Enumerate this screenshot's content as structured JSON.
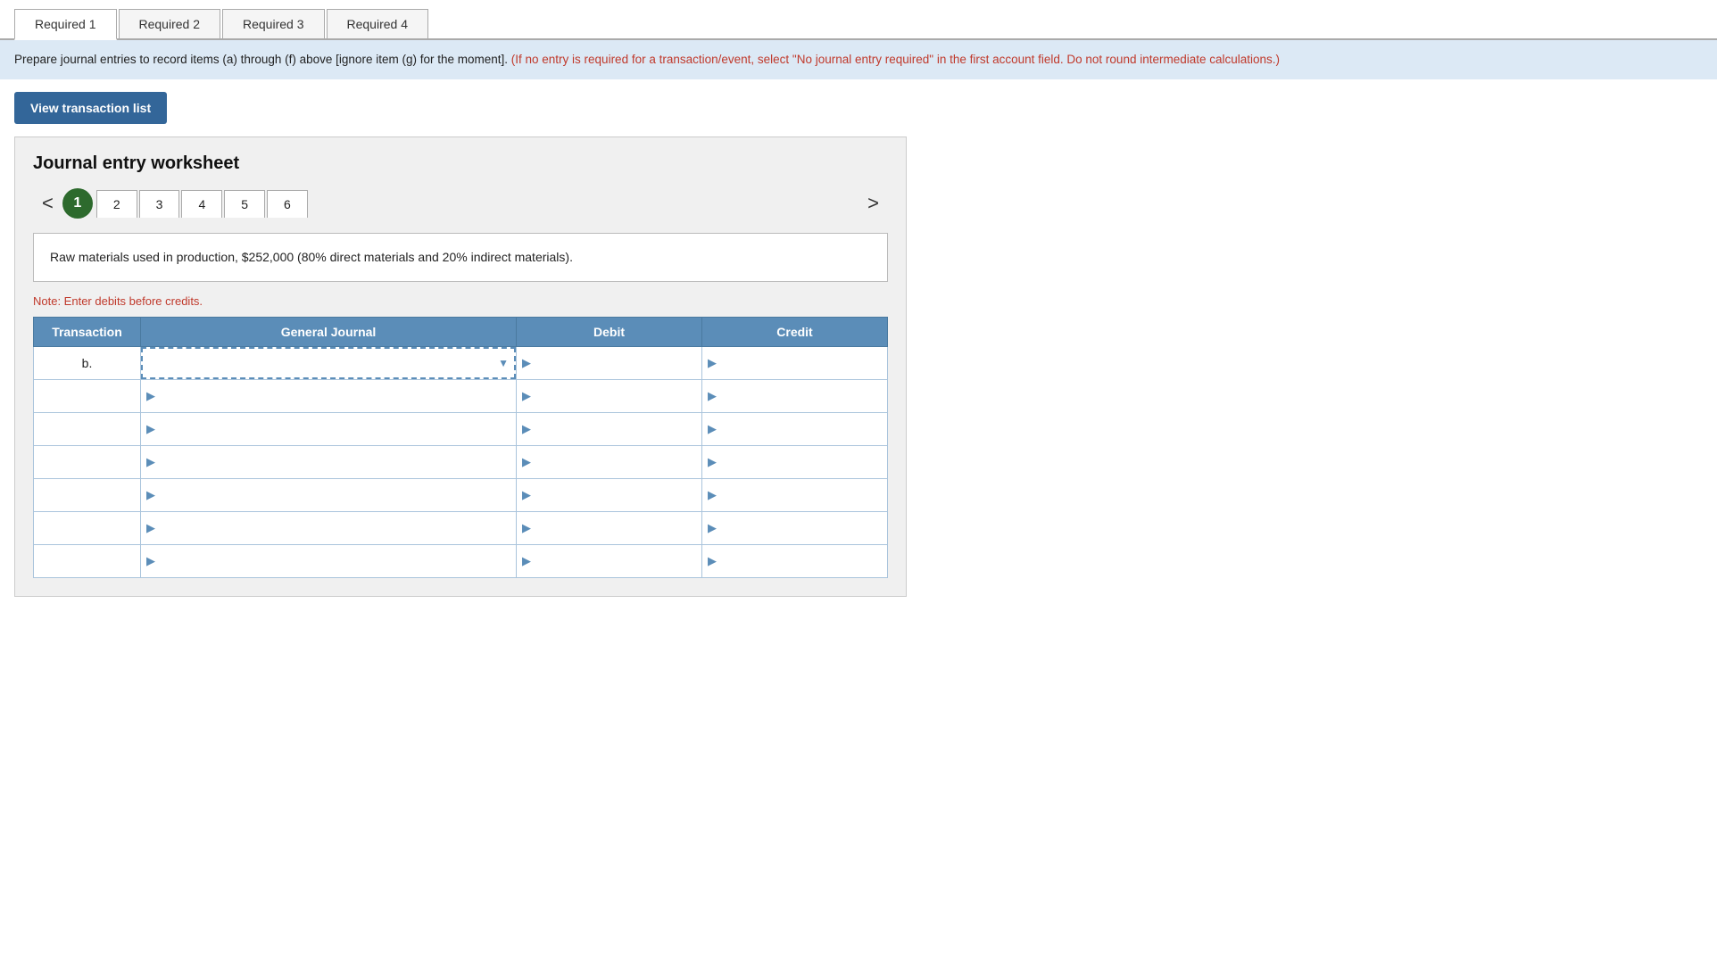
{
  "tabs": [
    {
      "label": "Required 1",
      "active": true
    },
    {
      "label": "Required 2",
      "active": false
    },
    {
      "label": "Required 3",
      "active": false
    },
    {
      "label": "Required 4",
      "active": false
    }
  ],
  "instruction": {
    "black_text": "Prepare journal entries to record items (a) through (f) above [ignore item (g) for the moment].",
    "red_text": "(If no entry is required for a transaction/event, select \"No journal entry required\" in the first account field. Do not round intermediate calculations.)"
  },
  "view_btn_label": "View transaction list",
  "worksheet": {
    "title": "Journal entry worksheet",
    "nav": {
      "left_arrow": "<",
      "right_arrow": ">",
      "active_page": "1",
      "pages": [
        "2",
        "3",
        "4",
        "5",
        "6"
      ]
    },
    "description": "Raw materials used in production, $252,000 (80% direct materials and 20% indirect materials).",
    "note": "Note: Enter debits before credits.",
    "table": {
      "headers": {
        "transaction": "Transaction",
        "general_journal": "General Journal",
        "debit": "Debit",
        "credit": "Credit"
      },
      "rows": [
        {
          "transaction": "b.",
          "journal": "",
          "debit": "",
          "credit": "",
          "first_row": true
        },
        {
          "transaction": "",
          "journal": "",
          "debit": "",
          "credit": "",
          "first_row": false
        },
        {
          "transaction": "",
          "journal": "",
          "debit": "",
          "credit": "",
          "first_row": false
        },
        {
          "transaction": "",
          "journal": "",
          "debit": "",
          "credit": "",
          "first_row": false
        },
        {
          "transaction": "",
          "journal": "",
          "debit": "",
          "credit": "",
          "first_row": false
        },
        {
          "transaction": "",
          "journal": "",
          "debit": "",
          "credit": "",
          "first_row": false
        },
        {
          "transaction": "",
          "journal": "",
          "debit": "",
          "credit": "",
          "first_row": false
        }
      ]
    }
  }
}
